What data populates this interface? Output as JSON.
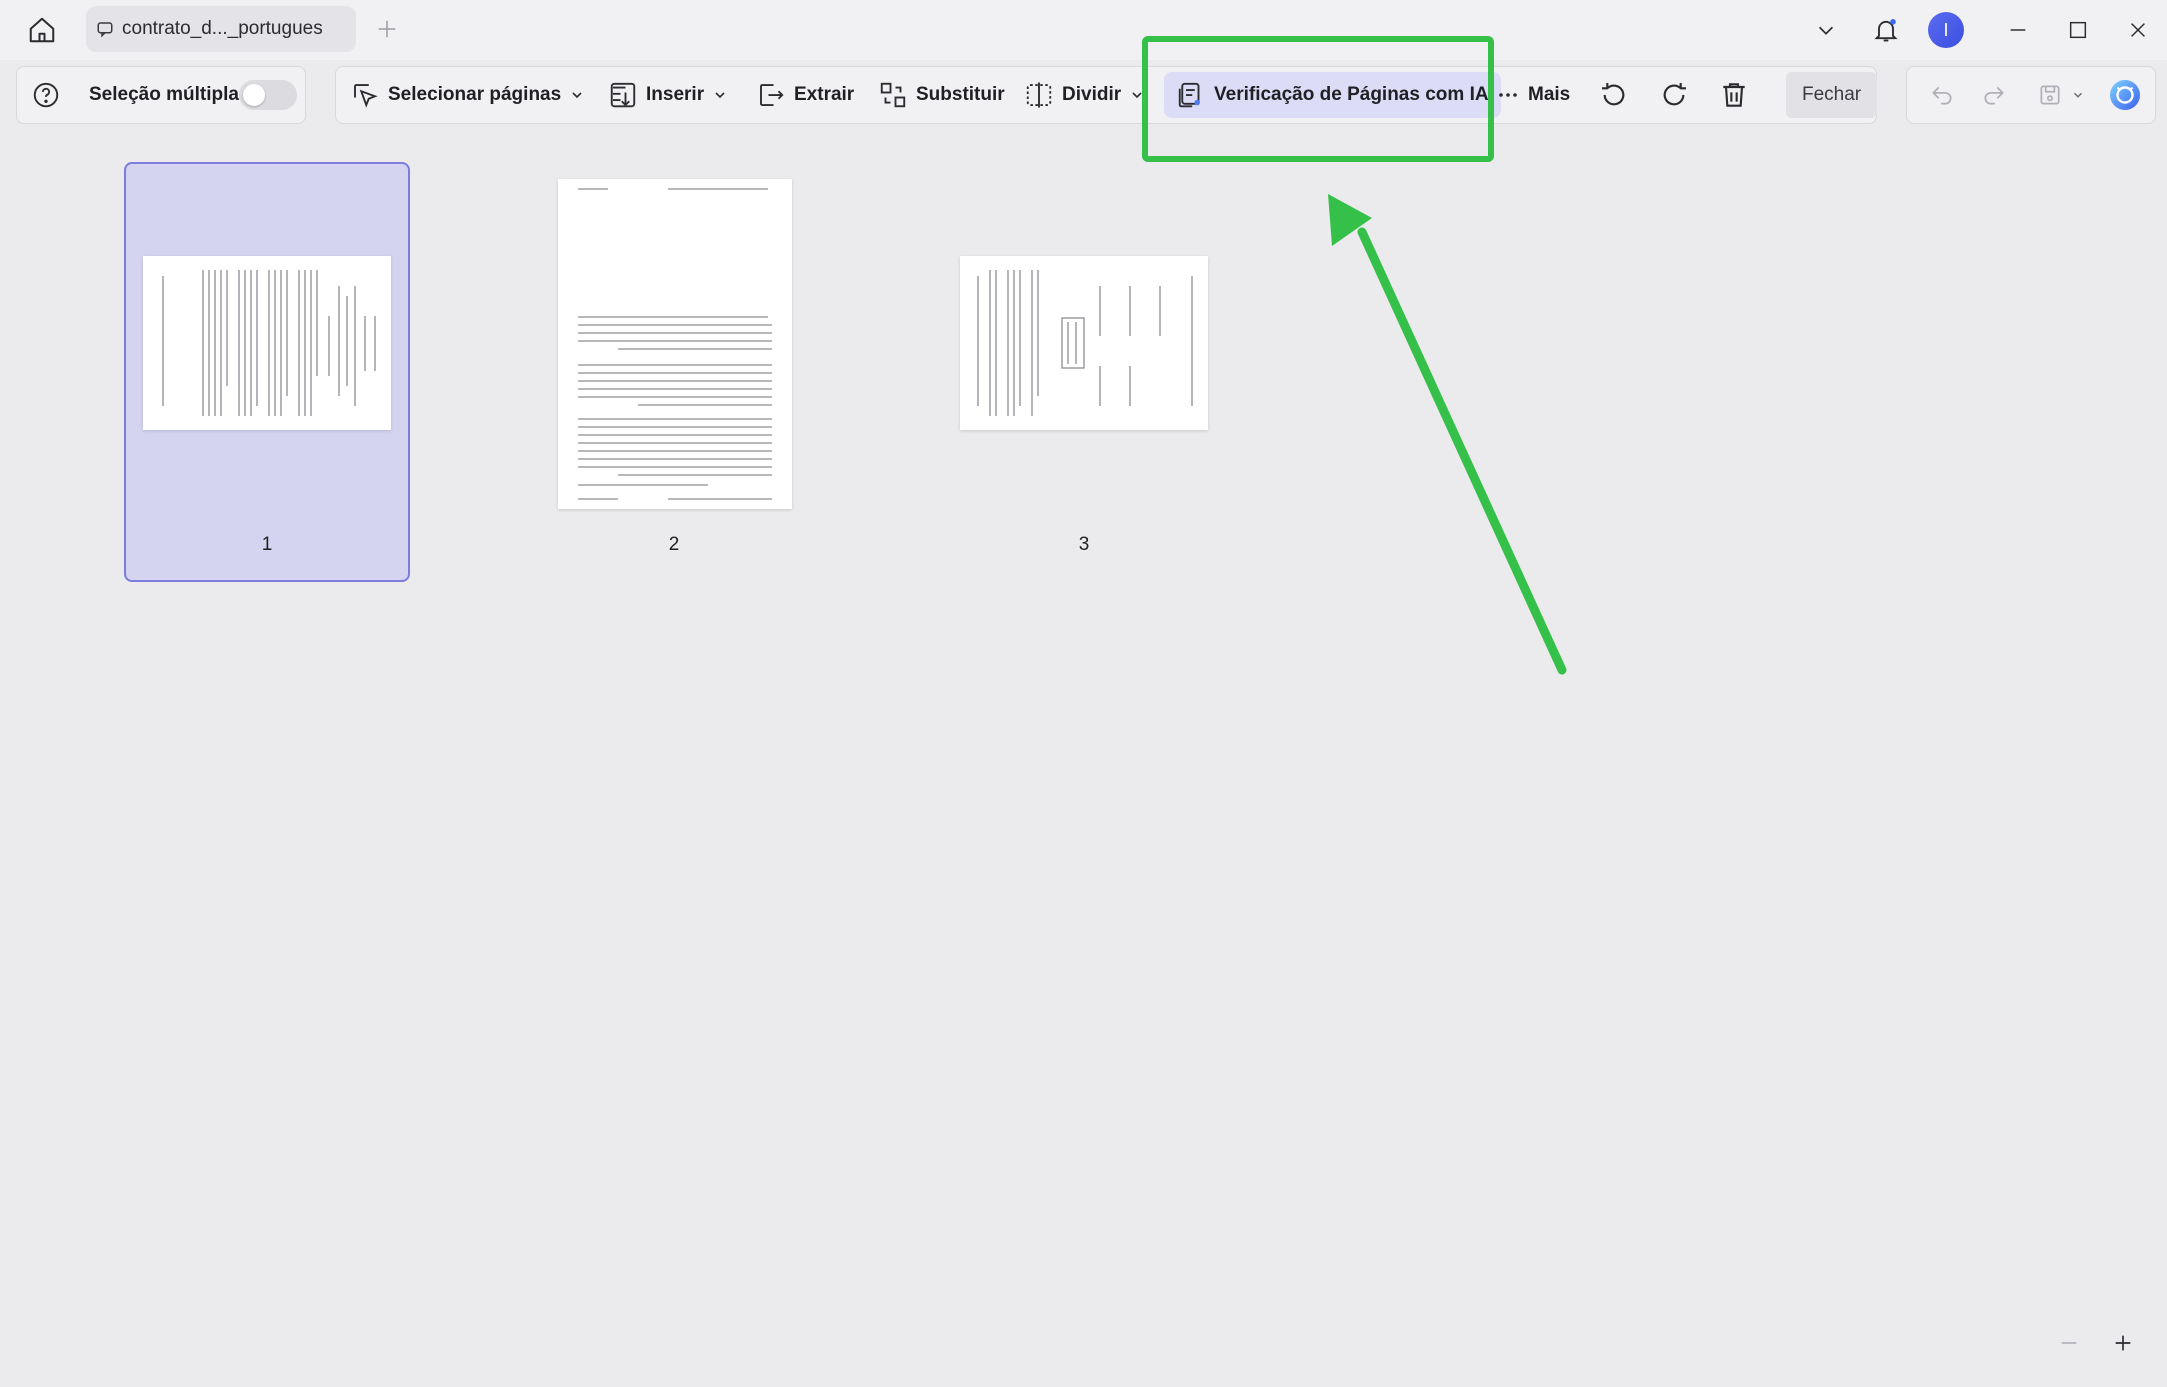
{
  "titlebar": {
    "tab_label": "contrato_d..._portugues",
    "avatar_letter": "I"
  },
  "toolbar": {
    "multi_select_label": "Seleção múltipla",
    "multi_select_on": false,
    "select_pages_label": "Selecionar páginas",
    "insert_label": "Inserir",
    "extract_label": "Extrair",
    "replace_label": "Substituir",
    "split_label": "Dividir",
    "ai_check_label": "Verificação de Páginas com IA",
    "more_label": "Mais",
    "close_label": "Fechar"
  },
  "pages": [
    {
      "number": "1",
      "selected": true,
      "orientation": "landscape"
    },
    {
      "number": "2",
      "selected": false,
      "orientation": "portrait"
    },
    {
      "number": "3",
      "selected": false,
      "orientation": "landscape"
    }
  ],
  "annotation": {
    "color": "#35c04a",
    "target": "ai_check_label"
  },
  "colors": {
    "accent": "#7d7de0",
    "selection_bg": "#d4d4f0",
    "annotation": "#35c04a"
  }
}
